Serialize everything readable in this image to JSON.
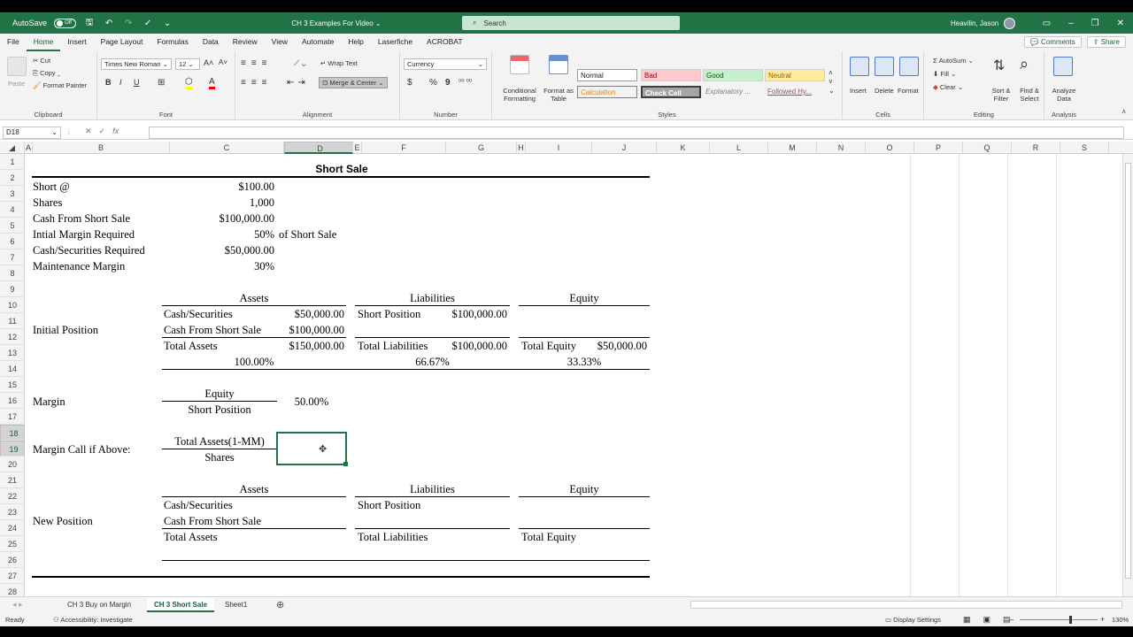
{
  "titlebar": {
    "autosave": "AutoSave",
    "autosave_state": "Off",
    "doc_title": "CH 3 Examples For Video ⌄",
    "search": "Search",
    "user": "Heavilin, Jason"
  },
  "tabs": [
    "File",
    "Home",
    "Insert",
    "Page Layout",
    "Formulas",
    "Data",
    "Review",
    "View",
    "Automate",
    "Help",
    "Laserfiche",
    "ACROBAT"
  ],
  "active_tab": "Home",
  "menu_right": {
    "comments": "Comments",
    "share": "Share"
  },
  "ribbon": {
    "clipboard": {
      "paste": "Paste",
      "cut": "Cut",
      "copy": "Copy",
      "format_painter": "Format Painter",
      "label": "Clipboard"
    },
    "font": {
      "name": "Times New Roman",
      "size": "12",
      "label": "Font",
      "bold": "B",
      "italic": "I",
      "underline": "U"
    },
    "alignment": {
      "wrap": "Wrap Text",
      "merge": "Merge & Center",
      "label": "Alignment"
    },
    "number": {
      "format": "Currency",
      "label": "Number",
      "dollar": "$",
      "percent": "%",
      "comma": "9"
    },
    "styles": {
      "cond": "Conditional Formatting",
      "table": "Format as Table",
      "normal": "Normal",
      "bad": "Bad",
      "good": "Good",
      "neutral": "Neutral",
      "calculation": "Calculation",
      "check": "Check Cell",
      "explanatory": "Explanatory ...",
      "followed": "Followed Hy...",
      "label": "Styles"
    },
    "cells": {
      "insert": "Insert",
      "delete": "Delete",
      "format": "Format",
      "label": "Cells"
    },
    "editing": {
      "autosum": "AutoSum",
      "fill": "Fill",
      "clear": "Clear",
      "sort": "Sort & Filter",
      "find": "Find & Select",
      "label": "Editing"
    },
    "analysis": {
      "analyze": "Analyze Data",
      "label": "Analysis"
    }
  },
  "formula_bar": {
    "name_box": "D18",
    "fx": "fx",
    "value": ""
  },
  "columns": [
    "A",
    "B",
    "C",
    "D",
    "E",
    "F",
    "G",
    "H",
    "I",
    "J",
    "K",
    "L",
    "M",
    "N",
    "O",
    "P",
    "Q",
    "R",
    "S"
  ],
  "rows": [
    "1",
    "2",
    "3",
    "4",
    "5",
    "6",
    "7",
    "8",
    "9",
    "10",
    "11",
    "12",
    "13",
    "14",
    "15",
    "16",
    "17",
    "18",
    "19",
    "20",
    "21",
    "22",
    "23",
    "24",
    "25",
    "26",
    "27",
    "28"
  ],
  "sheet": {
    "title": "Short Sale",
    "inputs": [
      {
        "label": "Short @",
        "value": "$100.00"
      },
      {
        "label": "Shares",
        "value": "1,000"
      },
      {
        "label": "Cash From Short Sale",
        "value": "$100,000.00"
      },
      {
        "label": "Intial Margin Required",
        "value": "50%",
        "note": "of Short Sale"
      },
      {
        "label": "Cash/Securities Required",
        "value": "$50,000.00"
      },
      {
        "label": "Maintenance Margin",
        "value": "30%"
      }
    ],
    "initial": {
      "label": "Initial Position",
      "assets_h": "Assets",
      "liab_h": "Liabilities",
      "equity_h": "Equity",
      "a1": "Cash/Securities",
      "a1v": "$50,000.00",
      "a2": "Cash From Short Sale",
      "a2v": "$100,000.00",
      "at": "Total Assets",
      "atv": "$150,000.00",
      "l1": "Short Position",
      "l1v": "$100,000.00",
      "lt": "Total Liabilities",
      "ltv": "$100,000.00",
      "et": "Total Equity",
      "etv": "$50,000.00",
      "pa": "100.00%",
      "pl": "66.67%",
      "pe": "33.33%"
    },
    "margin": {
      "label": "Margin",
      "num": "Equity",
      "den": "Short Position",
      "value": "50.00%"
    },
    "margin_call": {
      "label": "Margin Call if Above:",
      "num": "Total Assets(1-MM)",
      "den": "Shares"
    },
    "new_position": {
      "label": "New Position",
      "assets_h": "Assets",
      "liab_h": "Liabilities",
      "equity_h": "Equity",
      "a1": "Cash/Securities",
      "a2": "Cash From Short Sale",
      "at": "Total Assets",
      "l1": "Short Position",
      "lt": "Total Liabilities",
      "et": "Total Equity"
    }
  },
  "sheet_tabs": [
    "CH 3 Buy on Margin",
    "CH 3 Short Sale",
    "Sheet1"
  ],
  "active_sheet": "CH 3 Short Sale",
  "status": {
    "ready": "Ready",
    "accessibility": "Accessibility: Investigate",
    "display": "Display Settings",
    "zoom": "130%"
  }
}
